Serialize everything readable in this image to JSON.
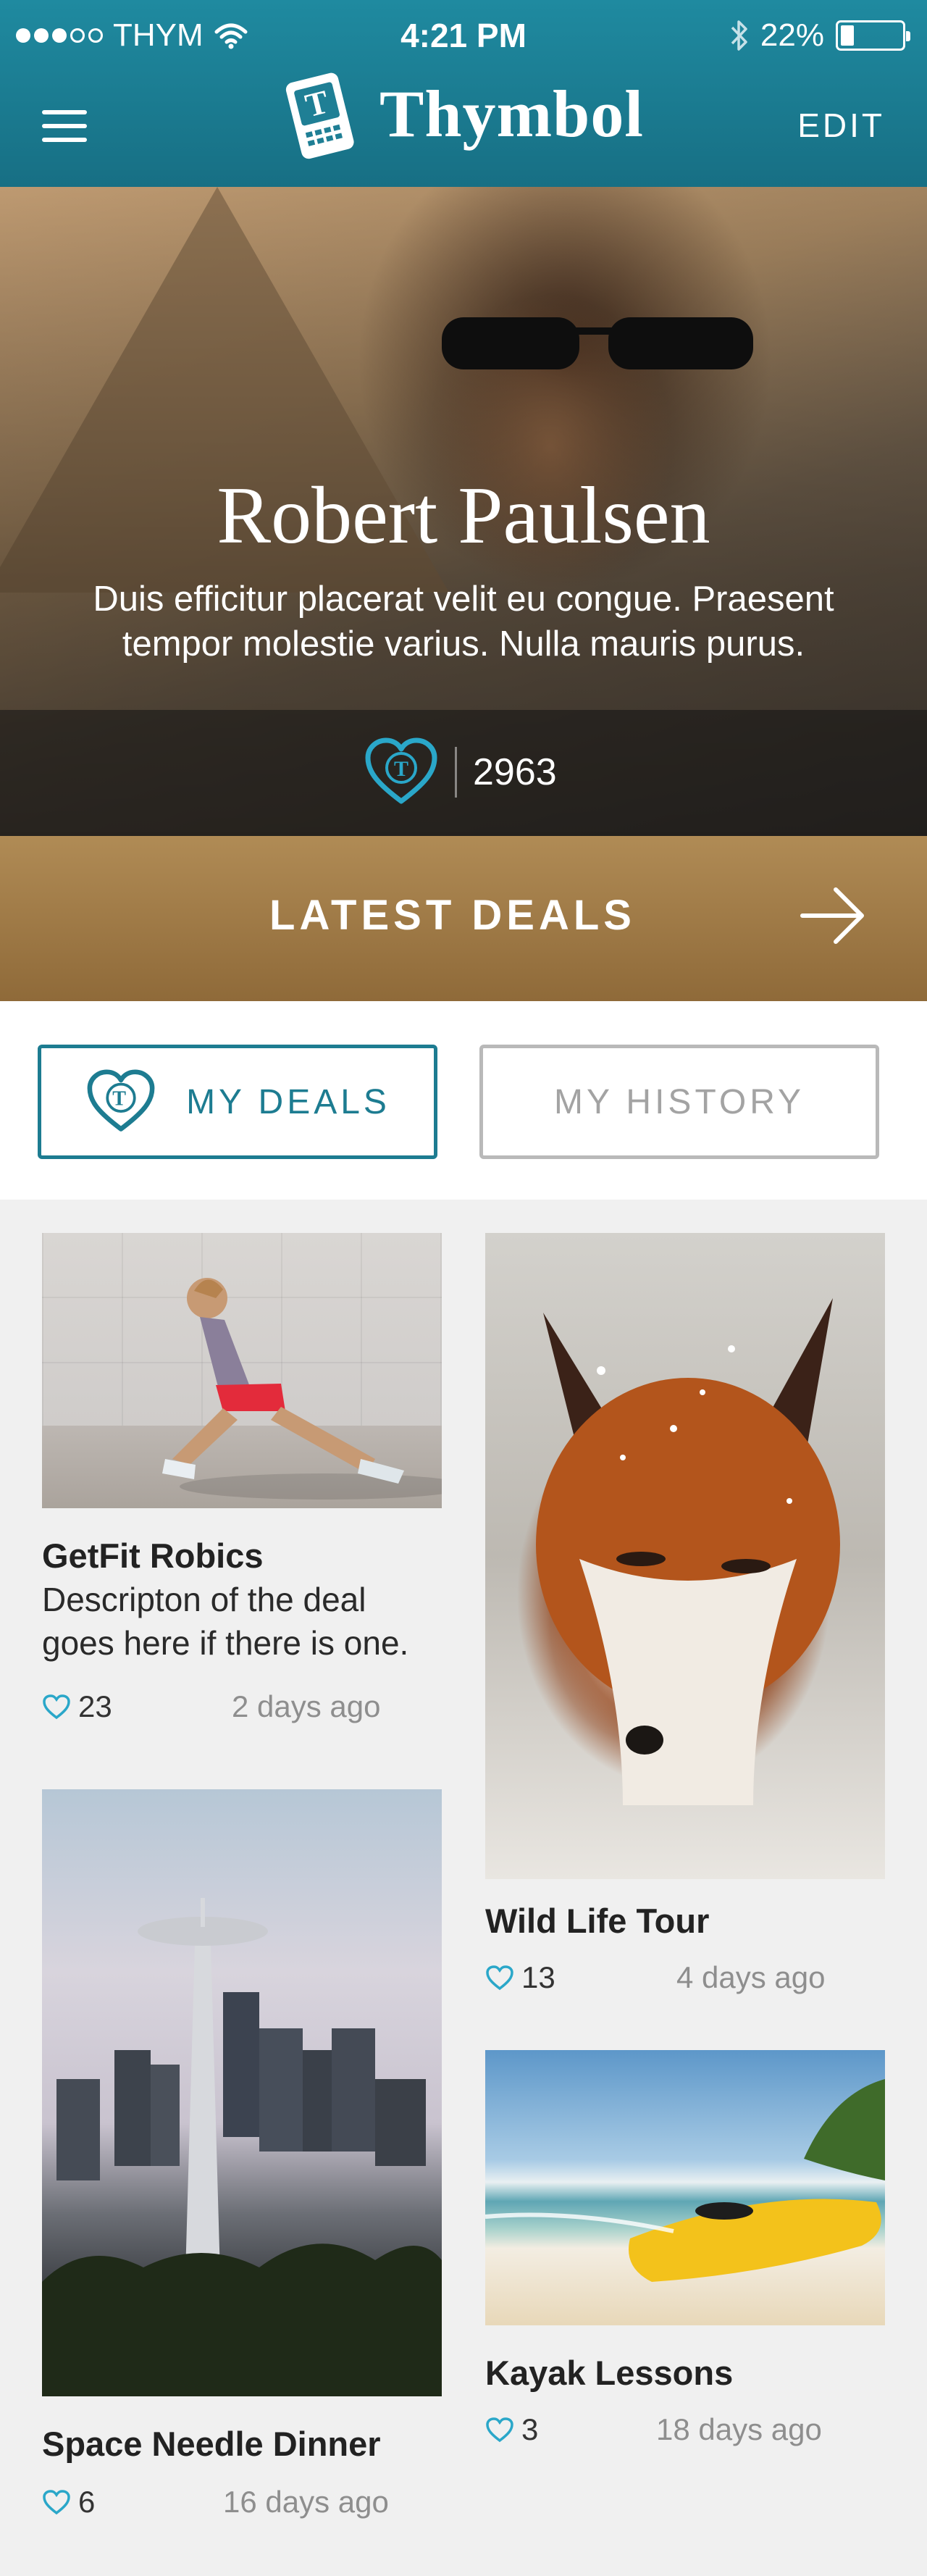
{
  "status_bar": {
    "carrier": "THYM",
    "time": "4:21 PM",
    "battery": "22%"
  },
  "nav": {
    "app_name": "Thymbol",
    "edit_label": "EDIT"
  },
  "profile": {
    "name": "Robert Paulsen",
    "bio": "Duis efficitur placerat velit eu congue. Praesent tempor molestie varius. Nulla mauris purus.",
    "like_count": "2963"
  },
  "latest_deals": {
    "label": "LATEST DEALS"
  },
  "tabs": {
    "my_deals": "MY DEALS",
    "my_history": "MY HISTORY"
  },
  "deals": [
    {
      "title": "GetFit Robics",
      "description": "Descripton of the deal goes here if there is one.",
      "likes": "23",
      "ago": "2 days ago"
    },
    {
      "title": "Wild Life Tour",
      "likes": "13",
      "ago": "4 days ago"
    },
    {
      "title": "Space Needle Dinner",
      "likes": "6",
      "ago": "16 days ago"
    },
    {
      "title": "Kayak Lessons",
      "likes": "3",
      "ago": "18 days ago"
    }
  ],
  "colors": {
    "header_teal": "#1f8aa0",
    "accent_teal": "#1d7c91",
    "gold": "#a67f49",
    "heart_blue": "#2aa7c9"
  }
}
